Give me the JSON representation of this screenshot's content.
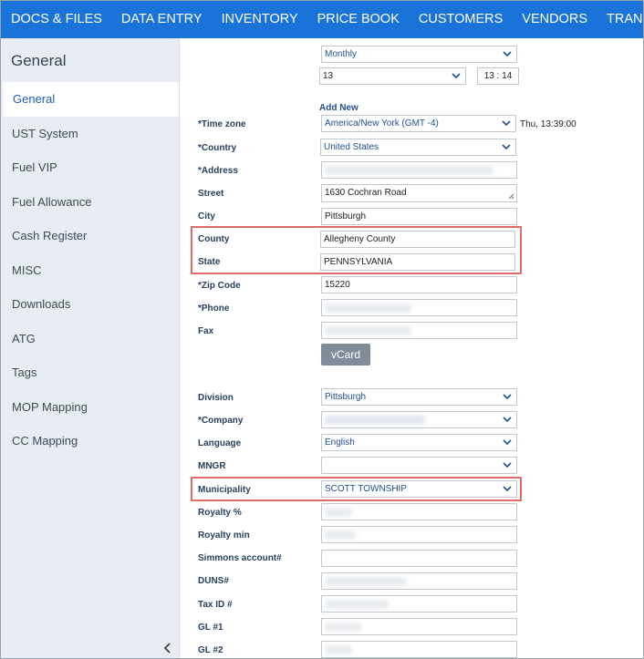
{
  "nav": [
    "DOCS & FILES",
    "DATA ENTRY",
    "INVENTORY",
    "PRICE BOOK",
    "CUSTOMERS",
    "VENDORS",
    "TRANSACTIONS"
  ],
  "sidebar": {
    "title": "General",
    "items": [
      "General",
      "UST System",
      "Fuel VIP",
      "Fuel Allowance",
      "Cash Register",
      "MISC",
      "Downloads",
      "ATG",
      "Tags",
      "MOP Mapping",
      "CC Mapping"
    ],
    "active_index": 0,
    "collapse_icon": "chevron-left-icon"
  },
  "form": {
    "frequency": "Monthly",
    "day": "13",
    "time_hh": "13",
    "time_mm": "14",
    "add_new": "Add New",
    "timezone_label": "*Time zone",
    "timezone": "America/New York (GMT -4)",
    "current_time": "Thu, 13:39:00",
    "country_label": "*Country",
    "country": "United States",
    "address_label": "*Address",
    "street_label": "Street",
    "street": "1630 Cochran Road",
    "city_label": "City",
    "city": "Pittsburgh",
    "county_label": "County",
    "county": "Allegheny County",
    "state_label": "State",
    "state": "PENNSYLVANIA",
    "zip_label": "*Zip Code",
    "zip": "15220",
    "phone_label": "*Phone",
    "fax_label": "Fax",
    "vcard": "vCard",
    "division_label": "Division",
    "division": "Pittsburgh",
    "company_label": "*Company",
    "language_label": "Language",
    "language": "English",
    "mngr_label": "MNGR",
    "municipality_label": "Municipality",
    "municipality": "SCOTT TOWNSHIP",
    "royalty_pct_label": "Royalty %",
    "royalty_min_label": "Royalty min",
    "simmons_label": "Simmons account#",
    "duns_label": "DUNS#",
    "taxid_label": "Tax ID #",
    "gl1_label": "GL #1",
    "gl2_label": "GL #2"
  },
  "colors": {
    "nav_bg": "#1a73d9",
    "highlight": "#e06b6b",
    "label": "#27415f"
  }
}
